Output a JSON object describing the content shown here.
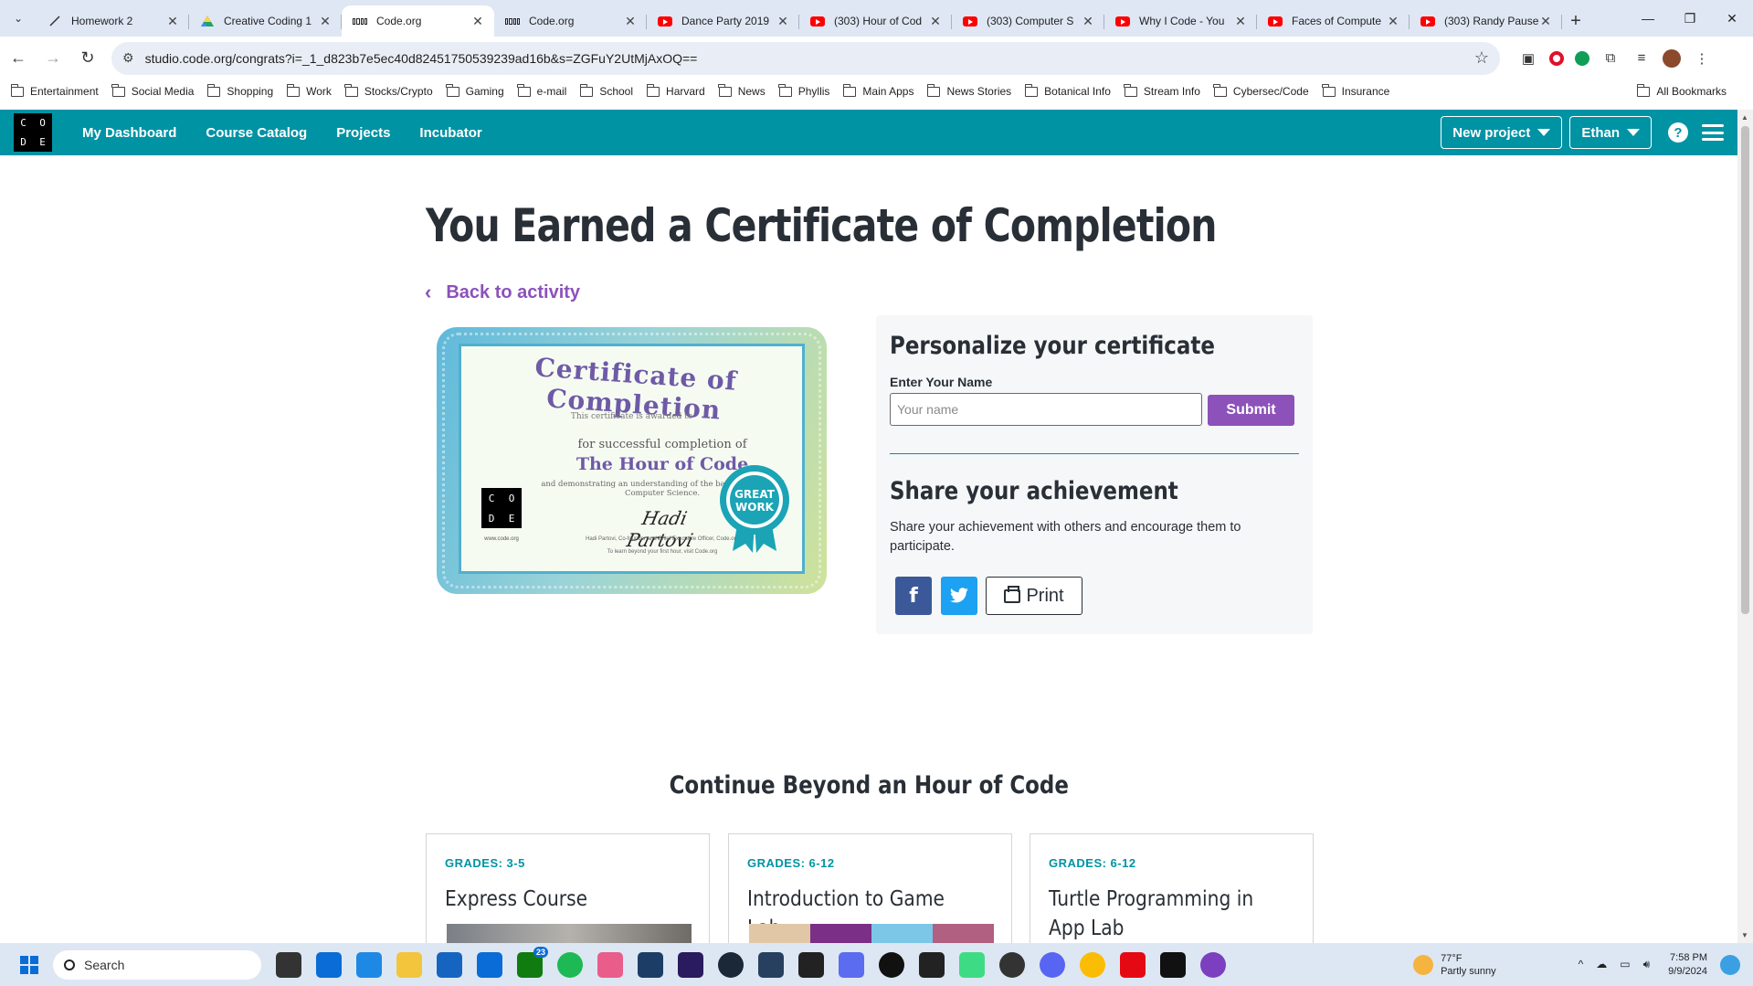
{
  "browser": {
    "tabs": [
      {
        "title": "Homework 2",
        "icon": "pen-icon",
        "active": false
      },
      {
        "title": "Creative Coding 1",
        "icon": "drive-icon",
        "active": false
      },
      {
        "title": "Code.org",
        "icon": "code-org-icon",
        "active": true
      },
      {
        "title": "Code.org",
        "icon": "code-org-icon",
        "active": false
      },
      {
        "title": "Dance Party 2019",
        "icon": "youtube-icon",
        "active": false
      },
      {
        "title": "(303) Hour of Cod",
        "icon": "youtube-icon",
        "active": false
      },
      {
        "title": "(303) Computer S",
        "icon": "youtube-icon",
        "active": false
      },
      {
        "title": "Why I Code - You",
        "icon": "youtube-icon",
        "active": false
      },
      {
        "title": "Faces of Compute",
        "icon": "youtube-icon",
        "active": false
      },
      {
        "title": "(303) Randy Pause",
        "icon": "youtube-icon",
        "active": false
      }
    ],
    "url": "studio.code.org/congrats?i=_1_d823b7e5ec40d82451750539239ad16b&s=ZGFuY2UtMjAxOQ==",
    "bookmarks": [
      "Entertainment",
      "Social Media",
      "Shopping",
      "Work",
      "Stocks/Crypto",
      "Gaming",
      "e-mail",
      "School",
      "Harvard",
      "News",
      "Phyllis",
      "Main Apps",
      "News Stories",
      "Botanical Info",
      "Stream Info",
      "Cybersec/Code",
      "Insurance"
    ],
    "all_bookmarks": "All Bookmarks"
  },
  "site": {
    "logo_letters": [
      "C",
      "O",
      "D",
      "E"
    ],
    "nav": [
      "My Dashboard",
      "Course Catalog",
      "Projects",
      "Incubator"
    ],
    "new_project": "New project",
    "user": "Ethan",
    "help": "?"
  },
  "page": {
    "title": "You Earned a Certificate of Completion",
    "back": "Back to activity"
  },
  "certificate": {
    "title": "Certificate of Completion",
    "awarded": "This certificate is awarded to",
    "for": "for successful completion of",
    "course": "The Hour of Code",
    "desc": "and demonstrating an understanding of the basic concepts of Computer Science.",
    "signature": "Hadi Partovi",
    "sig_title": "Hadi Partovi, Co-founder and Chief Executive Officer, Code.org",
    "footer": "To learn beyond your first hour, visit Code.org",
    "url": "www.code.org",
    "badge_top": "GREAT",
    "badge_bottom": "WORK"
  },
  "personalize": {
    "heading": "Personalize your certificate",
    "label": "Enter Your Name",
    "placeholder": "Your name",
    "submit": "Submit"
  },
  "share": {
    "heading": "Share your achievement",
    "text": "Share your achievement with others and encourage them to participate.",
    "facebook": "f",
    "print": "Print"
  },
  "continue": {
    "heading": "Continue Beyond an Hour of Code",
    "cards": [
      {
        "grade": "GRADES: 3-5",
        "title": "Express Course"
      },
      {
        "grade": "GRADES: 6-12",
        "title": "Introduction to Game Lab"
      },
      {
        "grade": "GRADES: 6-12",
        "title": "Turtle Programming in App Lab"
      }
    ]
  },
  "taskbar": {
    "search": "Search",
    "weather_temp": "77°F",
    "weather_desc": "Partly sunny",
    "time": "7:58 PM",
    "date": "9/9/2024",
    "badge_count": "23"
  },
  "colors": {
    "brand": "#0093a4",
    "accent": "#8c52ba"
  }
}
